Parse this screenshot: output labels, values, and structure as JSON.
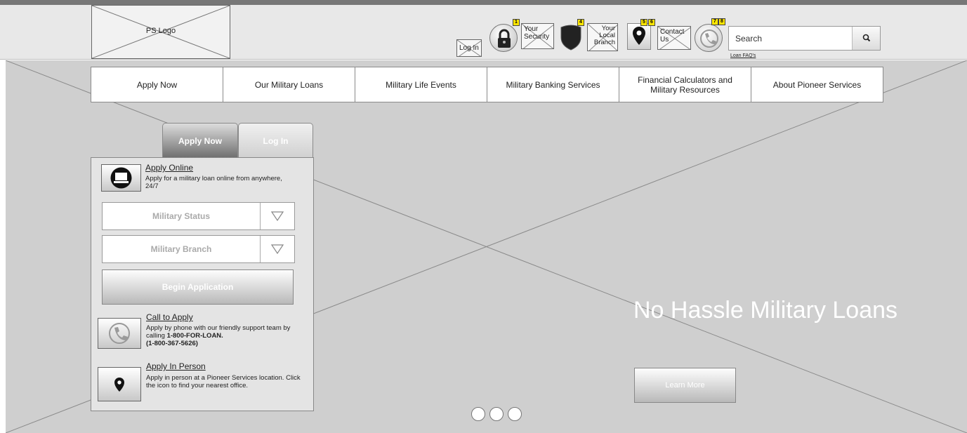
{
  "header": {
    "logo_text": "PS Logo",
    "utility": {
      "login_label": "Log In",
      "security_label": "Your Security",
      "branch_label": "Your Local Branch",
      "contact_label": "Contact Us",
      "badges": [
        "1",
        "4",
        "5",
        "6",
        "7",
        "8"
      ]
    },
    "search": {
      "placeholder": "Search"
    },
    "loan_faq": "Loan FAQ's"
  },
  "nav": {
    "items": [
      "Apply Now",
      "Our Military Loans",
      "Military Life Events",
      "Military Banking Services",
      "Financial Calculators and Military Resources",
      "About Pioneer Services"
    ]
  },
  "tabs": {
    "apply": "Apply Now",
    "login": "Log In"
  },
  "panel": {
    "online": {
      "title": "Apply Online",
      "desc": "Apply for a military loan online from anywhere, 24/7"
    },
    "military_status": "Military Status",
    "military_branch": "Military Branch",
    "begin": "Begin Application",
    "phone": {
      "title": "Call to Apply",
      "desc_1": "Apply by phone with our friendly support team by calling",
      "desc_2": "1-800-FOR-LOAN.",
      "desc_3": "(1-800-367-5626)"
    },
    "person": {
      "title": "Apply In Person",
      "desc": "Apply in person at a Pioneer Services location. Click the icon to find your nearest office."
    }
  },
  "hero": {
    "title": "No Hassle Military Loans",
    "button": "Learn More"
  },
  "colors": {
    "header_bg": "#e8e8e8",
    "hero_bg": "#cfcfcf",
    "badge": "#ffe600"
  }
}
